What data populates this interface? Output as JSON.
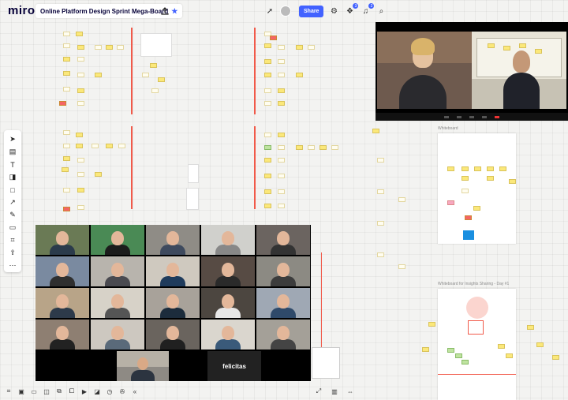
{
  "app": {
    "logo": "miro",
    "board_title": "Online Platform Design Sprint Mega-Board",
    "share_label": "Share",
    "notif_count_1": "3",
    "notif_count_2": "2"
  },
  "zoom_grid": {
    "featured_name": "felicitas"
  },
  "board": {
    "whiteboard_label": "Whiteboard",
    "whiteboard2_label": "Whiteboard for Insights Sharing - Day #1"
  },
  "icons": {
    "star": "star-icon",
    "upload": "upload-icon",
    "settings": "settings-icon",
    "notifications": "bell-icon",
    "search": "search-icon"
  },
  "colors": {
    "brand": "#050038",
    "accent": "#4262ff",
    "sticky": "#fbe87a",
    "line": "#f15a4a"
  }
}
